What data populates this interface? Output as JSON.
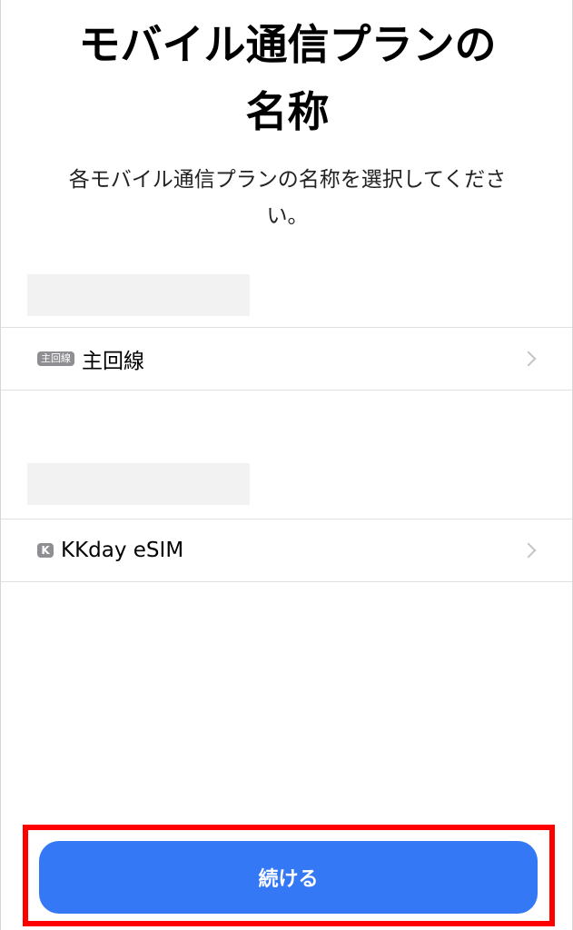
{
  "header": {
    "title_line1": "モバイル通信プランの",
    "title_line2": "名称",
    "subtitle_line1": "各モバイル通信プランの名称を選択してくださ",
    "subtitle_line2": "い。"
  },
  "plans": [
    {
      "badge": "主回線",
      "label": "主回線"
    },
    {
      "badge": "K",
      "label": "KKday eSIM"
    }
  ],
  "footer": {
    "continue_label": "続ける"
  },
  "colors": {
    "accent": "#3478f6",
    "highlight_frame": "#ff0000",
    "badge": "#8e8e93"
  }
}
